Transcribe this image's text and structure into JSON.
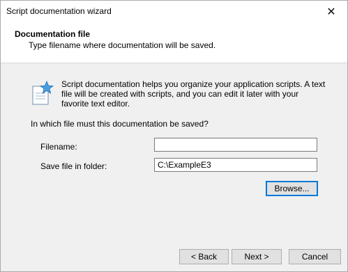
{
  "window": {
    "title": "Script documentation wizard",
    "close_glyph": "✕"
  },
  "header": {
    "title": "Documentation file",
    "subtitle": "Type filename where documentation will be saved."
  },
  "body": {
    "info_icon": "document-star-icon",
    "info_text": "Script documentation helps you organize your application scripts. A text file will be created with scripts, and you can edit it later with your favorite text editor.",
    "question": "In which file must this documentation be saved?",
    "filename_label": "Filename:",
    "filename_value": "",
    "folder_label": "Save file in folder:",
    "folder_value": "C:\\ExampleE3",
    "browse_label": "Browse..."
  },
  "footer": {
    "back_label": "< Back",
    "next_label": "Next >",
    "cancel_label": "Cancel"
  }
}
